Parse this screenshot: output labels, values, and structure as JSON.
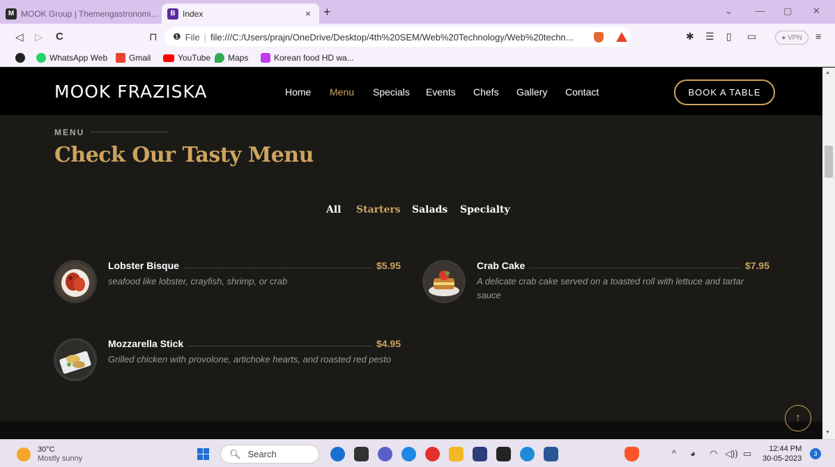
{
  "browser": {
    "tabs": [
      {
        "favicon": "M",
        "title": "MOOK Group | Themengastronomie a"
      },
      {
        "favicon": "B",
        "title": "Index",
        "close": "×"
      }
    ],
    "new_tab": "+",
    "window_controls": {
      "chevron": "⌄",
      "minimize": "—",
      "restore": "▢",
      "close": "✕"
    },
    "nav": {
      "back": "◁",
      "forward": "▷",
      "reload": "C",
      "bookmark": "⊓"
    },
    "address": {
      "info": "❶",
      "file_label": "File",
      "separator": "|",
      "url": "file:///C:/Users/prajn/OneDrive/Desktop/4th%20SEM/Web%20Technology/Web%20techn..."
    },
    "vpn_label": "● VPN",
    "menu": "≡",
    "bookmarks": [
      {
        "label": "WhatsApp Web",
        "color": "#25d366"
      },
      {
        "label": "Gmail",
        "color": "#ea4335"
      },
      {
        "label": "YouTube",
        "color": "#ff0000"
      },
      {
        "label": "Maps",
        "color": "#34a853"
      },
      {
        "label": "Korean food HD wa...",
        "color": "#c03af0"
      }
    ]
  },
  "site": {
    "logo": "MOOK FRAZISKA",
    "nav": [
      "Home",
      "Menu",
      "Specials",
      "Events",
      "Chefs",
      "Gallery",
      "Contact"
    ],
    "active_nav": "Menu",
    "book_button": "BOOK A TABLE",
    "section_label": "MENU",
    "section_title": "Check Our Tasty Menu",
    "filters": [
      "All",
      "Starters",
      "Salads",
      "Specialty"
    ],
    "active_filter": "Starters",
    "items": [
      {
        "name": "Lobster Bisque",
        "price": "$5.95",
        "desc": "seafood like lobster, crayfish, shrimp, or crab"
      },
      {
        "name": "Crab Cake",
        "price": "$7.95",
        "desc": "A delicate crab cake served on a toasted roll with lettuce and tartar sauce"
      },
      {
        "name": "Mozzarella Stick",
        "price": "$4.95",
        "desc": "Grilled chicken with provolone, artichoke hearts, and roasted red pesto"
      }
    ],
    "back_to_top": "↑"
  },
  "taskbar": {
    "temp": "30°C",
    "weather": "Mostly sunny",
    "search": "Search",
    "time": "12:44 PM",
    "date": "30-05-2023",
    "notifications": "3",
    "tray_chevron": "^"
  },
  "colors": {
    "accent": "#cda45e",
    "background": "#1b1a17",
    "header": "#000000",
    "chrome": "#d9c2ec"
  }
}
